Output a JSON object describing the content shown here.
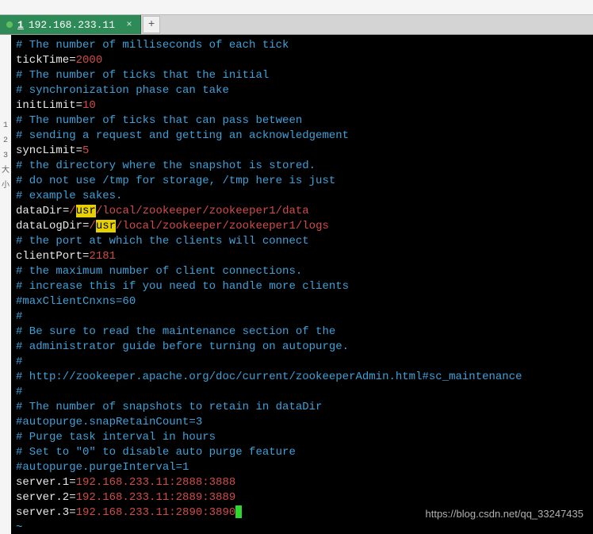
{
  "top_text": "",
  "tab": {
    "index": "1",
    "host": "192.168.233.11"
  },
  "gutter": [
    "1",
    "2",
    "3",
    "大",
    "小"
  ],
  "lines": [
    {
      "t": "comment",
      "text": "# The number of milliseconds of each tick"
    },
    {
      "t": "kv",
      "key": "tickTime",
      "val": "2000",
      "vcls": "c-num"
    },
    {
      "t": "comment",
      "text": "# The number of ticks that the initial"
    },
    {
      "t": "comment",
      "text": "# synchronization phase can take"
    },
    {
      "t": "kv",
      "key": "initLimit",
      "val": "10",
      "vcls": "c-num"
    },
    {
      "t": "comment",
      "text": "# The number of ticks that can pass between"
    },
    {
      "t": "comment",
      "text": "# sending a request and getting an acknowledgement"
    },
    {
      "t": "kv",
      "key": "syncLimit",
      "val": "5",
      "vcls": "c-num"
    },
    {
      "t": "comment",
      "text": "# the directory where the snapshot is stored."
    },
    {
      "t": "comment",
      "text": "# do not use /tmp for storage, /tmp here is just"
    },
    {
      "t": "comment",
      "text": "# example sakes."
    },
    {
      "t": "path",
      "key": "dataDir",
      "pre": "/",
      "hl": "usr",
      "post": "/local/zookeeper/zookeeper1/data"
    },
    {
      "t": "path",
      "key": "dataLogDir",
      "pre": "/",
      "hl": "usr",
      "post": "/local/zookeeper/zookeeper1/logs"
    },
    {
      "t": "comment",
      "text": "# the port at which the clients will connect"
    },
    {
      "t": "kv",
      "key": "clientPort",
      "val": "2181",
      "vcls": "c-num"
    },
    {
      "t": "comment",
      "text": "# the maximum number of client connections."
    },
    {
      "t": "comment",
      "text": "# increase this if you need to handle more clients"
    },
    {
      "t": "comment",
      "text": "#maxClientCnxns=60"
    },
    {
      "t": "comment",
      "text": "#"
    },
    {
      "t": "comment",
      "text": "# Be sure to read the maintenance section of the"
    },
    {
      "t": "comment",
      "text": "# administrator guide before turning on autopurge."
    },
    {
      "t": "comment",
      "text": "#"
    },
    {
      "t": "comment",
      "text": "# http://zookeeper.apache.org/doc/current/zookeeperAdmin.html#sc_maintenance"
    },
    {
      "t": "comment",
      "text": "#"
    },
    {
      "t": "comment",
      "text": "# The number of snapshots to retain in dataDir"
    },
    {
      "t": "comment",
      "text": "#autopurge.snapRetainCount=3"
    },
    {
      "t": "comment",
      "text": "# Purge task interval in hours"
    },
    {
      "t": "comment",
      "text": "# Set to \"0\" to disable auto purge feature"
    },
    {
      "t": "comment",
      "text": "#autopurge.purgeInterval=1"
    },
    {
      "t": "kv",
      "key": "server.1",
      "val": "192.168.233.11:2888:3888",
      "vcls": "c-val"
    },
    {
      "t": "kv",
      "key": "server.2",
      "val": "192.168.233.11:2889:3889",
      "vcls": "c-val"
    },
    {
      "t": "kvc",
      "key": "server.3",
      "val": "192.168.233.11:2890:3890",
      "vcls": "c-val"
    },
    {
      "t": "tilde",
      "text": "~"
    }
  ],
  "watermark": "https://blog.csdn.net/qq_33247435"
}
